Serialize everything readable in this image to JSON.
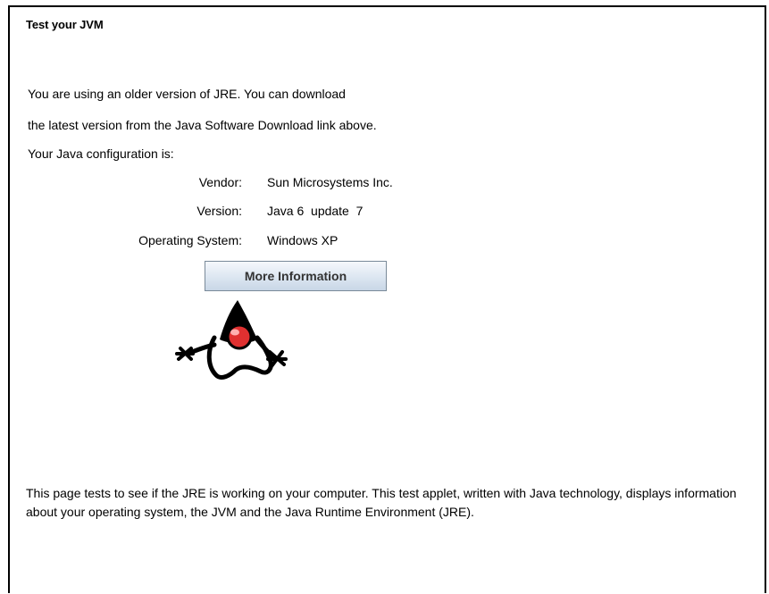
{
  "page": {
    "title": "Test your JVM"
  },
  "applet": {
    "intro_line1": "You are using an older version of JRE. You can download",
    "intro_line2": "the latest version from the Java Software Download link above.",
    "config_heading": "Your Java configuration is:",
    "config": {
      "vendor_label": "Vendor:",
      "vendor_value": "Sun Microsystems Inc.",
      "version_label": "Version:",
      "version_value": "Java 6  update  7",
      "os_label": "Operating System:",
      "os_value": "Windows XP"
    },
    "more_info_label": "More Information",
    "mascot_icon": "duke-java-mascot-icon"
  },
  "footer": {
    "description": "This page tests to see if the JRE is working on your computer. This test applet, written with Java technology, displays information about your operating system, the JVM and the Java Runtime Environment (JRE)."
  },
  "colors": {
    "button_border": "#7a8a99",
    "button_top": "#f5f8fc",
    "button_bottom": "#c8d6e6",
    "duke_nose": "#e03030"
  }
}
